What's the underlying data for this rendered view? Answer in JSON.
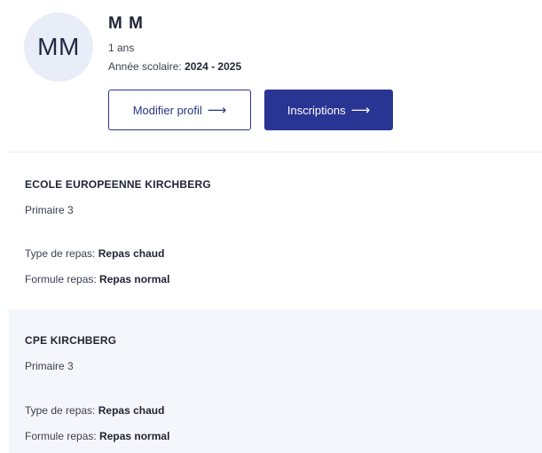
{
  "profile": {
    "initials": "MM",
    "name": "M M",
    "age": "1 ans",
    "school_year_label": "Année scolaire:",
    "school_year_value": "2024 - 2025"
  },
  "actions": {
    "edit_profile": "Modifier profil",
    "registrations": "Inscriptions",
    "arrow_glyph": "⟶"
  },
  "enrollments": [
    {
      "school": "ECOLE EUROPEENNE KIRCHBERG",
      "grade": "Primaire 3",
      "meal_type_label": "Type de repas:",
      "meal_type_value": "Repas chaud",
      "meal_formula_label": "Formule repas:",
      "meal_formula_value": "Repas normal"
    },
    {
      "school": "CPE KIRCHBERG",
      "grade": "Primaire 3",
      "meal_type_label": "Type de repas:",
      "meal_type_value": "Repas chaud",
      "meal_formula_label": "Formule repas:",
      "meal_formula_value": "Repas normal"
    }
  ],
  "colors": {
    "primary": "#293593",
    "avatar_bg": "#e8edf7",
    "alt_row_bg": "#f4f6fb"
  }
}
